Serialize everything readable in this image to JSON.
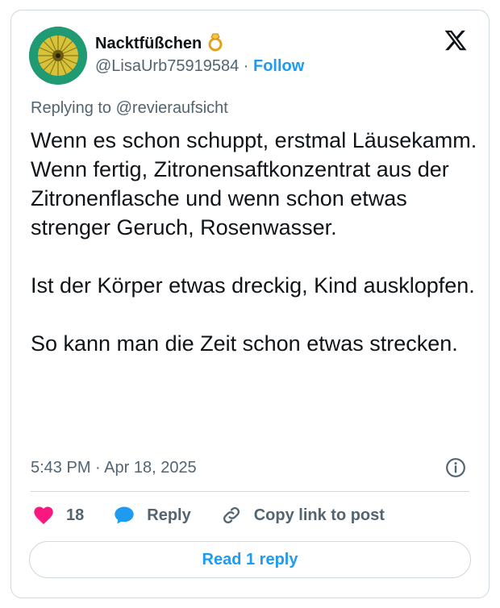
{
  "author": {
    "display_name": "Nacktfüßchen",
    "handle": "@LisaUrb75919584",
    "separator": "·",
    "follow_label": "Follow",
    "badge_icon": "ring-emoji-icon"
  },
  "platform_icon": "x-logo-icon",
  "reply_context": {
    "prefix": "Replying to",
    "mention": "@revieraufsicht"
  },
  "tweet": {
    "paragraphs": [
      "Wenn es schon schuppt, erstmal Läusekamm. Wenn fertig, Zitronensaftkonzentrat aus der Zitronenflasche und wenn schon etwas strenger Geruch, Rosenwasser.",
      "Ist der Körper etwas dreckig, Kind ausklopfen.",
      "So kann man die Zeit schon etwas strecken."
    ],
    "timestamp": "5:43 PM · Apr 18, 2025"
  },
  "actions": {
    "like_count": "18",
    "reply_label": "Reply",
    "copy_link_label": "Copy link to post"
  },
  "read_replies_label": "Read 1 reply",
  "colors": {
    "accent": "#1d9bf0",
    "like": "#f91880",
    "muted": "#536471",
    "border": "#cfd9de"
  }
}
